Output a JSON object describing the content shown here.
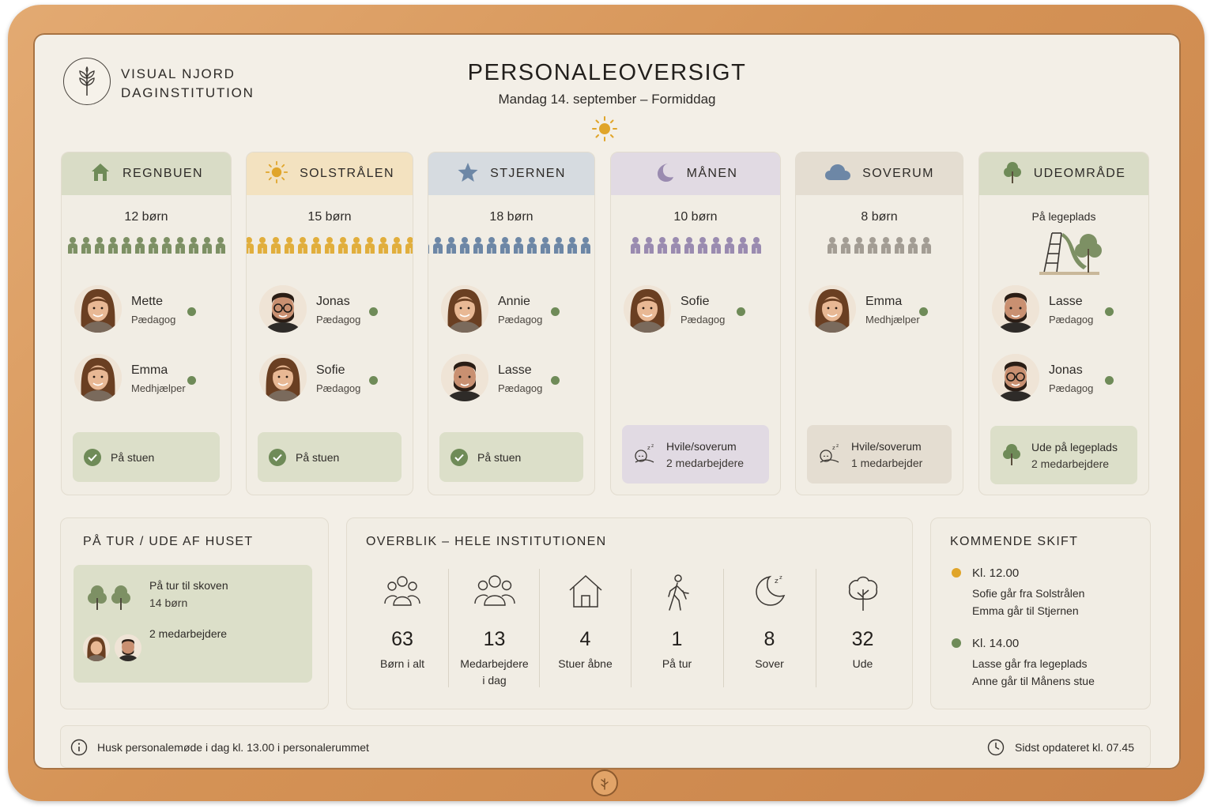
{
  "brand": {
    "line1": "VISUAL NJORD",
    "line2": "DAGINSTITUTION"
  },
  "header": {
    "title": "PERSONALEOVERSIGT",
    "subtitle": "Mandag 14. september – Formiddag"
  },
  "colors": {
    "accent_green": "#6f8b58",
    "sun": "#e0a52a",
    "frame_wood": "#d59356",
    "bg": "#f3efe7"
  },
  "rooms": [
    {
      "name": "REGNBUEN",
      "icon": "house-icon",
      "count": "12 børn",
      "kids": 12,
      "head_color": "#d9dcc6",
      "kid_color": "#7d9064",
      "staff": [
        {
          "name": "Mette",
          "role": "Pædagog"
        },
        {
          "name": "Emma",
          "role": "Medhjælper"
        }
      ],
      "status": {
        "line1": "På stuen",
        "line2": ""
      }
    },
    {
      "name": "SOLSTRÅLEN",
      "icon": "sun-icon",
      "count": "15 børn",
      "kids": 15,
      "head_color": "#f3e2c0",
      "kid_color": "#e1ae3c",
      "staff": [
        {
          "name": "Jonas",
          "role": "Pædagog"
        },
        {
          "name": "Sofie",
          "role": "Pædagog"
        }
      ],
      "status": {
        "line1": "På stuen",
        "line2": ""
      }
    },
    {
      "name": "STJERNEN",
      "icon": "star-icon",
      "count": "18 børn",
      "kids": 18,
      "head_color": "#d6dbe0",
      "kid_color": "#6d87a6",
      "staff": [
        {
          "name": "Annie",
          "role": "Pædagog"
        },
        {
          "name": "Lasse",
          "role": "Pædagog"
        }
      ],
      "status": {
        "line1": "På stuen",
        "line2": ""
      }
    },
    {
      "name": "MÅNEN",
      "icon": "moon-icon",
      "count": "10 børn",
      "kids": 10,
      "head_color": "#e1dae3",
      "kid_color": "#9a8bb0",
      "staff": [
        {
          "name": "Sofie",
          "role": "Pædagog"
        }
      ],
      "status": {
        "line1": "Hvile/soverum",
        "line2": "2 medarbejdere"
      }
    },
    {
      "name": "SOVERUM",
      "icon": "cloud-icon",
      "count": "8 børn",
      "kids": 8,
      "head_color": "#e4ddd1",
      "kid_color": "#a39d94",
      "staff": [
        {
          "name": "Emma",
          "role": "Medhjælper"
        }
      ],
      "status": {
        "line1": "Hvile/soverum",
        "line2": "1 medarbejder"
      }
    },
    {
      "name": "UDEOMRÅDE",
      "icon": "tree-icon",
      "count": "På legeplads",
      "kids": 0,
      "head_color": "#d9dcc6",
      "kid_color": "#7d9064",
      "staff": [
        {
          "name": "Lasse",
          "role": "Pædagog"
        },
        {
          "name": "Jonas",
          "role": "Pædagog"
        }
      ],
      "status": {
        "line1": "Ude på legeplads",
        "line2": "2 medarbejdere"
      }
    }
  ],
  "trip": {
    "title": "PÅ TUR / UDE AF HUSET",
    "line1": "På tur til skoven",
    "line2": "14 børn",
    "staff": "2 medarbejdere"
  },
  "overview": {
    "title": "OVERBLIK – HELE INSTITUTIONEN",
    "stats": [
      {
        "value": "63",
        "label": "Børn i alt",
        "label2": "",
        "icon": "children-group-icon"
      },
      {
        "value": "13",
        "label": "Medarbejdere",
        "label2": "i dag",
        "icon": "staff-group-icon"
      },
      {
        "value": "4",
        "label": "Stuer åbne",
        "label2": "",
        "icon": "house-outline-icon"
      },
      {
        "value": "1",
        "label": "På tur",
        "label2": "",
        "icon": "walking-person-icon"
      },
      {
        "value": "8",
        "label": "Sover",
        "label2": "",
        "icon": "moon-outline-icon"
      },
      {
        "value": "32",
        "label": "Ude",
        "label2": "",
        "icon": "tree-outline-icon"
      }
    ]
  },
  "shifts": {
    "title": "KOMMENDE SKIFT",
    "items": [
      {
        "time": "Kl. 12.00",
        "line1": "Sofie går fra Solstrålen",
        "line2": "Emma går til Stjernen",
        "color": "#e0a52a"
      },
      {
        "time": "Kl. 14.00",
        "line1": "Lasse går fra legeplads",
        "line2": "Anne går til Månens stue",
        "color": "#6f8b58"
      }
    ]
  },
  "footer": {
    "note": "Husk personalemøde i dag kl. 13.00 i personalerummet",
    "updated": "Sidst opdateret kl. 07.45"
  }
}
